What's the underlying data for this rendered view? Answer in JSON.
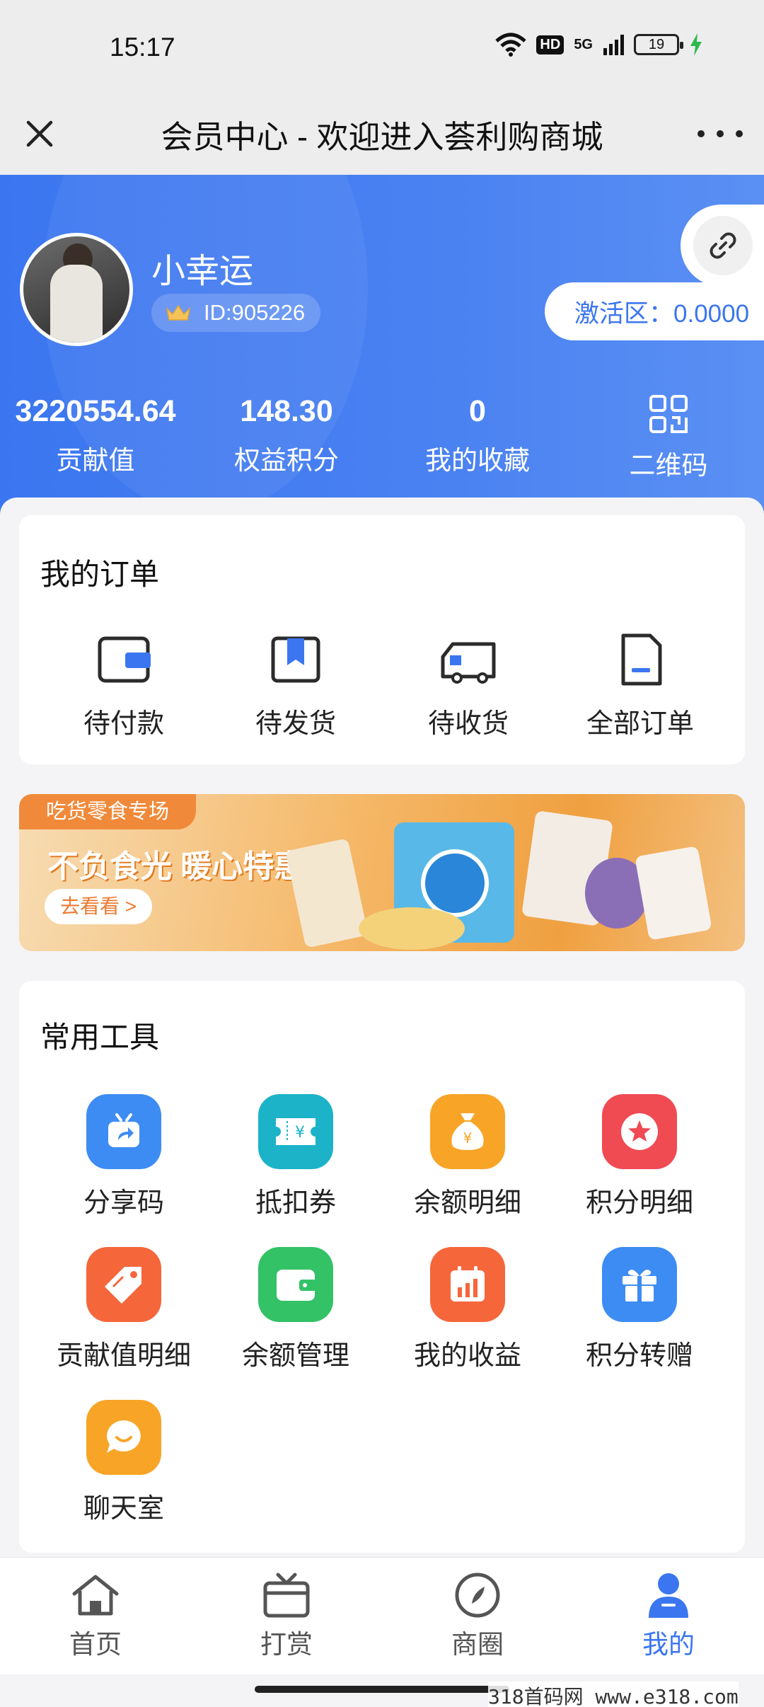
{
  "status_bar": {
    "time": "15:17",
    "network": "5G",
    "hd": "HD",
    "battery": "19"
  },
  "title_bar": {
    "title": "会员中心 - 欢迎进入荟利购商城"
  },
  "profile": {
    "name": "小幸运",
    "id": "ID:905226",
    "activate": "激活区：0.0000"
  },
  "stats": [
    {
      "value": "3220554.64",
      "label": "贡献值"
    },
    {
      "value": "148.30",
      "label": "权益积分"
    },
    {
      "value": "0",
      "label": "我的收藏"
    },
    {
      "label": "二维码"
    }
  ],
  "orders": {
    "title": "我的订单",
    "items": [
      {
        "label": "待付款",
        "icon": "wallet-icon"
      },
      {
        "label": "待发货",
        "icon": "bookmark-box-icon"
      },
      {
        "label": "待收货",
        "icon": "truck-icon"
      },
      {
        "label": "全部订单",
        "icon": "document-icon"
      }
    ]
  },
  "banner": {
    "tag": "吃货零食专场",
    "title": "不负食光 暖心特惠",
    "button": "去看看 >"
  },
  "tools": {
    "title": "常用工具",
    "items": [
      {
        "label": "分享码",
        "icon": "share-box-icon",
        "color": "#3d8cf4"
      },
      {
        "label": "抵扣券",
        "icon": "coupon-icon",
        "color": "#1cb3c8"
      },
      {
        "label": "余额明细",
        "icon": "money-bag-icon",
        "color": "#f8a427"
      },
      {
        "label": "积分明细",
        "icon": "star-icon",
        "color": "#f04a53"
      },
      {
        "label": "贡献值明细",
        "icon": "tag-icon",
        "color": "#f5663b"
      },
      {
        "label": "余额管理",
        "icon": "wallet-icon",
        "color": "#33c266"
      },
      {
        "label": "我的收益",
        "icon": "calendar-chart-icon",
        "color": "#f5663b"
      },
      {
        "label": "积分转赠",
        "icon": "gift-icon",
        "color": "#3d8cf4"
      },
      {
        "label": "聊天室",
        "icon": "chat-icon",
        "color": "#f8a427"
      }
    ]
  },
  "bottom_nav": {
    "items": [
      {
        "label": "首页",
        "icon": "home-icon"
      },
      {
        "label": "打赏",
        "icon": "tv-gift-icon"
      },
      {
        "label": "商圈",
        "icon": "compass-icon"
      },
      {
        "label": "我的",
        "icon": "user-icon",
        "active": true
      }
    ]
  },
  "watermark": "318首码网 www.e318.com",
  "colors": {
    "accent": "#3b76f0",
    "header_start": "#3b76f0",
    "banner_orange": "#f08a3a"
  }
}
